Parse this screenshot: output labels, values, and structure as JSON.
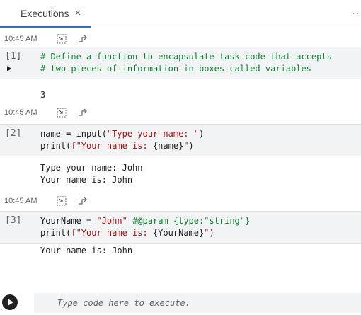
{
  "tab": {
    "label": "Executions",
    "close": "×",
    "more": "··"
  },
  "executions": [
    {
      "time": "10:45 AM",
      "number": "[1]",
      "code": [
        [
          {
            "t": "# Define a function to encapsulate task code that accepts",
            "c": "c-cmt"
          }
        ],
        [
          {
            "t": "# two pieces of information in boxes called variables",
            "c": "c-cmt"
          }
        ]
      ],
      "output": [
        "3"
      ]
    },
    {
      "time": "10:45 AM",
      "number": "[2]",
      "code": [
        [
          {
            "t": "name = input(",
            "c": ""
          },
          {
            "t": "\"Type your name: \"",
            "c": "c-str"
          },
          {
            "t": ")",
            "c": ""
          }
        ],
        [
          {
            "t": "print(",
            "c": ""
          },
          {
            "t": "f\"Your name is: ",
            "c": "c-str"
          },
          {
            "t": "{name}",
            "c": ""
          },
          {
            "t": "\"",
            "c": "c-str"
          },
          {
            "t": ")",
            "c": ""
          }
        ]
      ],
      "output": [
        "Type your name: John",
        "Your name is: John"
      ]
    },
    {
      "time": "10:45 AM",
      "number": "[3]",
      "code": [
        [
          {
            "t": "YourName = ",
            "c": ""
          },
          {
            "t": "\"John\"",
            "c": "c-str"
          },
          {
            "t": " #@param {type:\"string\"}",
            "c": "c-cmt"
          }
        ],
        [
          {
            "t": "print(",
            "c": ""
          },
          {
            "t": "f\"Your name is: ",
            "c": "c-str"
          },
          {
            "t": "{YourName}",
            "c": ""
          },
          {
            "t": "\"",
            "c": "c-str"
          },
          {
            "t": ")",
            "c": ""
          }
        ]
      ],
      "output": [
        "Your name is: John"
      ]
    }
  ],
  "input": {
    "placeholder": "Type code here to execute."
  },
  "colors": {
    "accent": "#1a73e8",
    "comment": "#188038",
    "string": "#a31515",
    "cell_bg": "#f1f3f4"
  }
}
